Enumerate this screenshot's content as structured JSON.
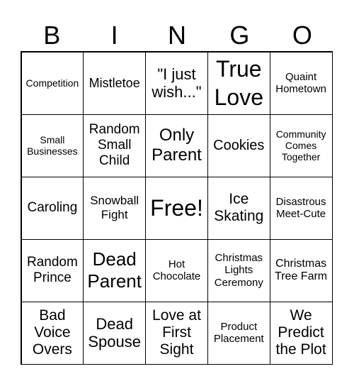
{
  "header": [
    "B",
    "I",
    "N",
    "G",
    "O"
  ],
  "cells": [
    [
      "Competition",
      "Mistletoe",
      "\"I just wish...\"",
      "True Love",
      "Quaint Hometown"
    ],
    [
      "Small Businesses",
      "Random Small Child",
      "Only Parent",
      "Cookies",
      "Community Comes Together"
    ],
    [
      "Caroling",
      "Snowball Fight",
      "Free!",
      "Ice Skating",
      "Disastrous Meet-Cute"
    ],
    [
      "Random Prince",
      "Dead Parent",
      "Hot Chocolate",
      "Christmas Lights Ceremony",
      "Christmas Tree Farm"
    ],
    [
      "Bad Voice Overs",
      "Dead Spouse",
      "Love at First Sight",
      "Product Placement",
      "We Predict the Plot"
    ]
  ]
}
